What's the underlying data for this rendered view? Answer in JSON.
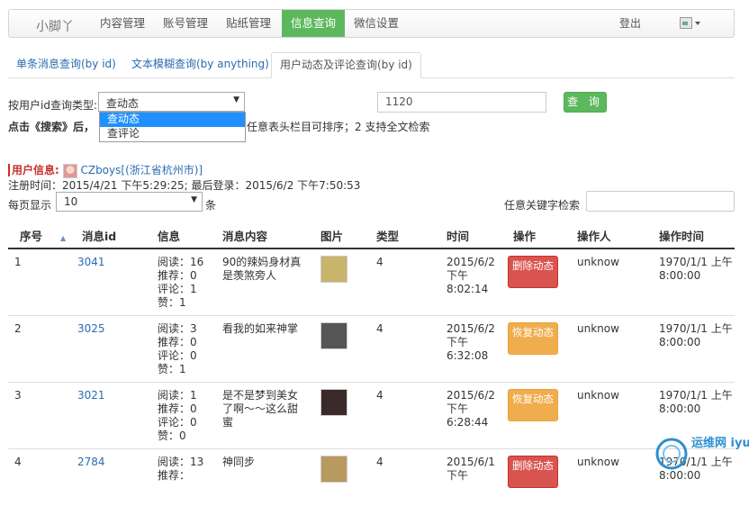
{
  "nav": {
    "brand": "小脚丫",
    "items": [
      {
        "label": "内容管理"
      },
      {
        "label": "账号管理"
      },
      {
        "label": "贴纸管理"
      },
      {
        "label": "信息查询"
      },
      {
        "label": "微信设置"
      }
    ],
    "logout": "登出"
  },
  "tabs": [
    {
      "label": "单条消息查询(by id)"
    },
    {
      "label": "文本模糊查询(by anything)"
    },
    {
      "label": "用户动态及评论查询(by id)"
    }
  ],
  "query": {
    "label": "按用户id查询类型:",
    "selected": "查动态",
    "options": [
      "查动态",
      "查评论"
    ],
    "id_value": "1120",
    "button": "查 询",
    "hint_bold": "点击《搜索》后，",
    "hint_rest": "任意表头栏目可排序；2 支持全文检索"
  },
  "user": {
    "label": "用户信息:",
    "name": "CZboys[(浙江省杭州市)]",
    "reg": "注册时间：2015/4/21 下午5:29:25; 最后登录：2015/6/2 下午7:50:53"
  },
  "controls": {
    "perpage_label": "每页显示",
    "perpage_value": "10",
    "perpage_unit": "条",
    "keyword_label": "任意关键字检索"
  },
  "table": {
    "headers": [
      "序号",
      "消息id",
      "信息",
      "消息内容",
      "图片",
      "类型",
      "时间",
      "操作",
      "操作人",
      "操作时间"
    ],
    "rows": [
      {
        "no": "1",
        "id": "3041",
        "info": [
          "阅读：16",
          "推荐：0",
          "评论：1",
          "赞：1"
        ],
        "content": "90的辣妈身材真是羡煞旁人",
        "type": "4",
        "time": [
          "2015/6/2",
          "下午",
          "8:02:14"
        ],
        "action": "删除动态",
        "action_kind": "delete",
        "operator": "unknow",
        "optime": [
          "1970/1/1 上午",
          "8:00:00"
        ],
        "thumb_color": "#c8b46a"
      },
      {
        "no": "2",
        "id": "3025",
        "info": [
          "阅读：3",
          "推荐：0",
          "评论：0",
          "赞：1"
        ],
        "content": "看我的如来神掌",
        "type": "4",
        "time": [
          "2015/6/2",
          "下午",
          "6:32:08"
        ],
        "action": "恢复动态",
        "action_kind": "recover",
        "operator": "unknow",
        "optime": [
          "1970/1/1 上午",
          "8:00:00"
        ],
        "thumb_color": "#555555"
      },
      {
        "no": "3",
        "id": "3021",
        "info": [
          "阅读：1",
          "推荐：0",
          "评论：0",
          "赞：0"
        ],
        "content": "是不是梦到美女了啊～～这么甜蜜",
        "type": "4",
        "time": [
          "2015/6/2",
          "下午",
          "6:28:44"
        ],
        "action": "恢复动态",
        "action_kind": "recover",
        "operator": "unknow",
        "optime": [
          "1970/1/1 上午",
          "8:00:00"
        ],
        "thumb_color": "#3a2a2a"
      },
      {
        "no": "4",
        "id": "2784",
        "info": [
          "阅读：13",
          "推荐："
        ],
        "content": "神同步",
        "type": "4",
        "time": [
          "2015/6/1",
          "下午"
        ],
        "action": "删除动态",
        "action_kind": "delete",
        "operator": "unknow",
        "optime": [
          "1970/1/1 上午",
          "8:00:00"
        ],
        "thumb_color": "#b89a60"
      }
    ]
  },
  "colors": {
    "active_nav": "#5cb85c",
    "delete": "#d9534f",
    "recover": "#f0ad4e",
    "link": "#2a6db0"
  },
  "watermark": "运维网 iyunv.com"
}
